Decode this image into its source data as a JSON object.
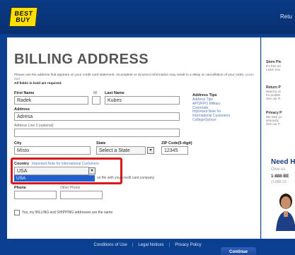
{
  "header": {
    "logo_top": "BEST",
    "logo_bottom": "BUY",
    "top_link": "Retu"
  },
  "form": {
    "title": "BILLING ADDRESS",
    "intro": "Please use the address that appears on your credit card statement. Incomplete or incorrect information may result in a delay or cancellation of your order.",
    "intro_tail": "Learn mor",
    "required_note": "All fields in bold are required.",
    "first_name_label": "First Name",
    "mi_label": "MI",
    "last_name_label": "Last Name",
    "first_name_value": "Radek",
    "mi_value": "",
    "last_name_value": "Kubes",
    "address_label": "Address",
    "address_value": "Adresa",
    "address2_label": "Address Line 2 (optional)",
    "address2_value": "",
    "city_label": "City",
    "city_value": "Místo",
    "state_label": "State",
    "state_value": "Select a State",
    "zip_label": "ZIP Code(5 digit)",
    "zip_value": "12345",
    "country_label": "Country",
    "country_link": "Important Note for International Customers",
    "country_value": "USA",
    "country_option_highlighted": "USA",
    "cc_note": "on file with your credit card company",
    "phone_label": "Phone",
    "other_phone_label": "Other Phone",
    "same_address_label": "Yes, my BILLING and SHIPPING addresses are the same.",
    "continue_label": "Continue"
  },
  "tips": {
    "title": "Address Tips",
    "links": [
      "Address Tips",
      "APO/FPO Military",
      "Corporate",
      "Important Note for",
      "International Customers",
      "College/School"
    ]
  },
  "sidebar": {
    "store_pickup_title": "Store Pic",
    "store_pickup_lines": [
      "It's free an",
      "Learn mor"
    ],
    "return_title": "Return P",
    "return_lines": [
      "Need to re",
      "for probler",
      "See our R"
    ],
    "privacy_title": "Privacy P",
    "privacy_lines": [
      "We take yo",
      "seriously.",
      "See our P"
    ],
    "need_help": "Need H",
    "give_us": "Give us",
    "phone": "1-888-BE",
    "phone2": "(1-888-23"
  },
  "footer": {
    "links": [
      "Conditions of Use",
      "Legal Notices",
      "Privacy Policy"
    ],
    "separator": "|"
  },
  "colors": {
    "brand_blue": "#0b3f8f",
    "logo_yellow": "#ffe000",
    "highlight_red": "#d8191c",
    "link_blue": "#5a78b4"
  }
}
